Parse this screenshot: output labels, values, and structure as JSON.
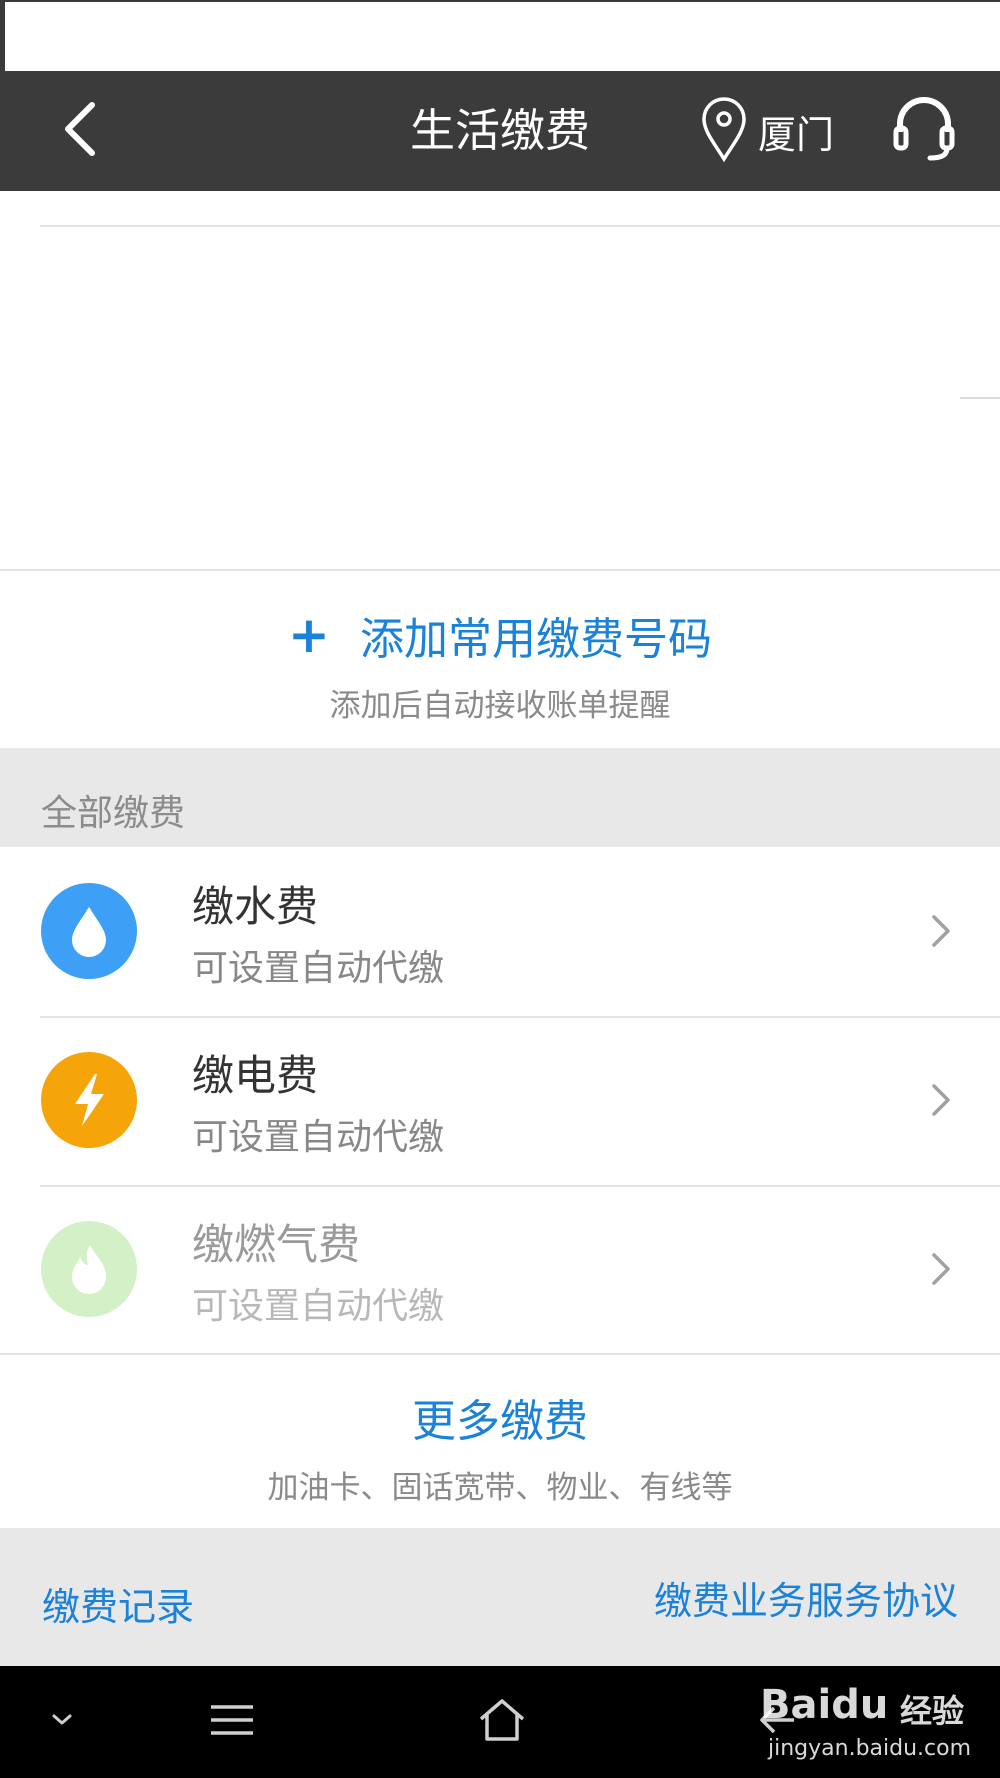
{
  "header": {
    "title": "生活缴费",
    "location": "厦门",
    "icons": {
      "back": "chevron-left-icon",
      "location": "map-pin-icon",
      "service": "headset-icon"
    }
  },
  "add_number": {
    "plus": "+",
    "title": "添加常用缴费号码",
    "subtitle": "添加后自动接收账单提醒"
  },
  "section": {
    "title": "全部缴费"
  },
  "items": [
    {
      "title": "缴水费",
      "subtitle": "可设置自动代缴",
      "icon": "water-drop-icon",
      "color": "#3d9ff5",
      "enabled": true
    },
    {
      "title": "缴电费",
      "subtitle": "可设置自动代缴",
      "icon": "lightning-icon",
      "color": "#f5a50a",
      "enabled": true
    },
    {
      "title": "缴燃气费",
      "subtitle": "可设置自动代缴",
      "icon": "flame-icon",
      "color": "#d3f0c6",
      "enabled": false
    }
  ],
  "more": {
    "title": "更多缴费",
    "subtitle": "加油卡、固话宽带、物业、有线等"
  },
  "footer": {
    "records": "缴费记录",
    "agreement": "缴费业务服务协议"
  },
  "watermark": {
    "brand": "Baidu",
    "cn": "经验",
    "url": "jingyan.baidu.com"
  },
  "colors": {
    "accent": "#1a82d8",
    "topbar": "#3b3b3b",
    "section_bg": "#e8e8e8"
  }
}
